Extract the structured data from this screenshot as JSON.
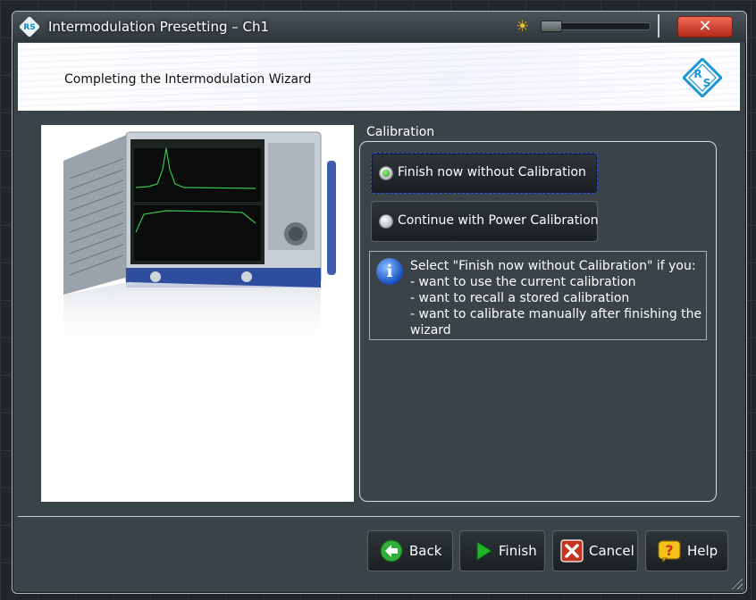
{
  "window": {
    "title": "Intermodulation Presetting – Ch1",
    "app_icon": "rohde-schwarz-logo",
    "logo_letters": "RS",
    "brightness_icon": "sun-icon",
    "close_label": "✕"
  },
  "header": {
    "title": "Completing the Intermodulation Wizard",
    "brand_logo": "rohde-schwarz-diamond-logo"
  },
  "calibration": {
    "group_label": "Calibration",
    "options": [
      {
        "label": "Finish now without Calibration",
        "selected": true
      },
      {
        "label": "Continue with Power Calibration",
        "selected": false
      }
    ],
    "info": {
      "icon": "info-icon",
      "glyph": "i",
      "lines": [
        "Select \"Finish now without Calibration\" if you:",
        "- want to use the current calibration",
        "- want to recall a stored calibration",
        "- want to calibrate manually after finishing the",
        "wizard"
      ]
    }
  },
  "footer": {
    "back_label": "Back",
    "finish_label": "Finish",
    "cancel_label": "Cancel",
    "help_label": "Help"
  },
  "colors": {
    "accent_blue": "#1589c9",
    "close_red": "#c33320",
    "finish_green": "#22b32a",
    "help_yellow": "#f2c21a"
  }
}
